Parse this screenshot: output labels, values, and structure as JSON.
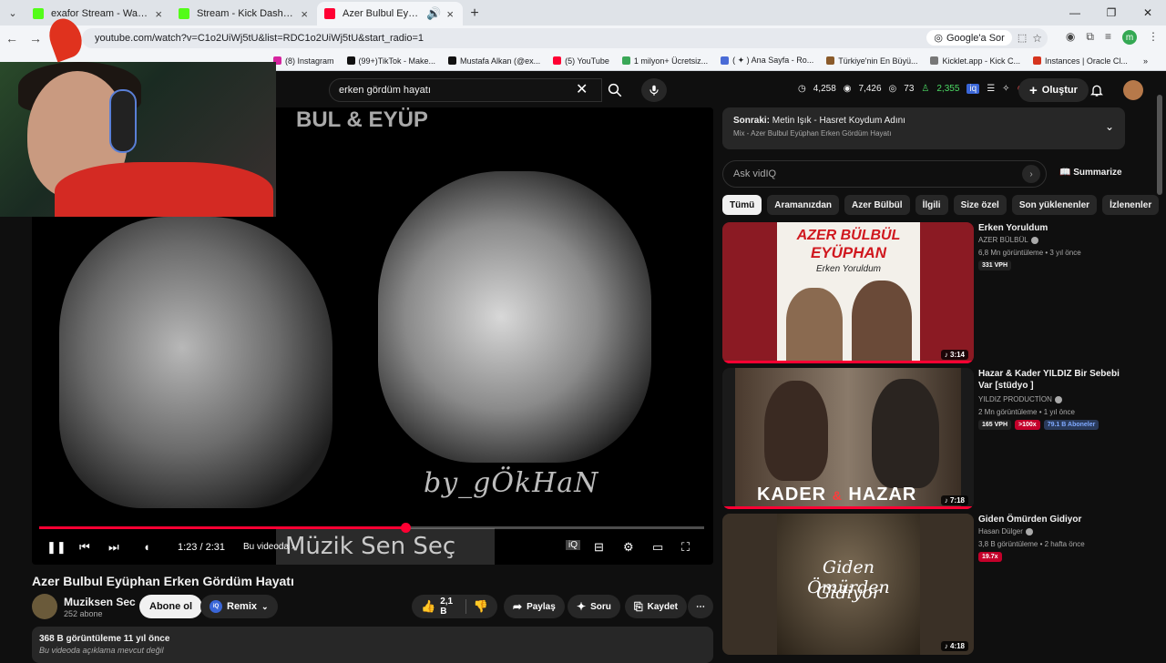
{
  "browser": {
    "tabs": [
      {
        "title": "exafor Stream - Watch Live on K",
        "favicon": "kick",
        "active": false
      },
      {
        "title": "Stream - Kick Dashboard",
        "favicon": "kick",
        "active": false
      },
      {
        "title": "Azer Bulbul Eyüphan Erken",
        "favicon": "youtube",
        "active": true
      }
    ],
    "url": "youtube.com/watch?v=C1o2UiWj5tU&list=RDC1o2UiWj5tU&start_radio=1",
    "google_ask": "Google'a Sor",
    "profile_letter": "m",
    "bookmarks": [
      {
        "label": "(8) Instagram",
        "color": "#d6249f"
      },
      {
        "label": "(99+)TikTok - Make...",
        "color": "#111111"
      },
      {
        "label": "Mustafa Alkan (@ex...",
        "color": "#111111"
      },
      {
        "label": "(5) YouTube",
        "color": "#ff0033"
      },
      {
        "label": "1 milyon+ Ücretsiz...",
        "color": "#3aa757"
      },
      {
        "label": "( ✦ ) Ana Sayfa - Ro...",
        "color": "#4a6bd6"
      },
      {
        "label": "Türkiye'nin En Büyü...",
        "color": "#8a5a2a"
      },
      {
        "label": "Kicklet.app - Kick C...",
        "color": "#777777"
      },
      {
        "label": "Instances | Oracle Cl...",
        "color": "#d6341e"
      }
    ]
  },
  "youtube": {
    "search_value": "erken gördüm hayatı",
    "stats": {
      "clock": "4,258",
      "views": "7,426",
      "eye": "73",
      "users": "2,355"
    },
    "create_label": "Oluştur",
    "video": {
      "top_watermark": "BUL & EYÜP",
      "watermark": "by_gÖkHaN",
      "banner": "Müzik Sen Seç",
      "time": "1:23 / 2:31",
      "progress": 0.55,
      "chapter": "Bu videoda"
    },
    "title": "Azer Bulbul Eyüphan Erken Gördüm Hayatı",
    "channel": {
      "name": "Muziksen Sec",
      "subs": "252 abone"
    },
    "subscribe_label": "Abone ol",
    "remix_label": "Remix",
    "actions": {
      "like": "2,1 B",
      "share": "Paylaş",
      "ask": "Soru",
      "save": "Kaydet"
    },
    "description": {
      "views": "368 B görüntüleme  11 yıl önce",
      "text": "Bu videoda açıklama mevcut değil"
    },
    "next_up": {
      "label": "Sonraki:",
      "title": "Metin Işık - Hasret Koydum Adını",
      "sub": "Mix - Azer Bulbul Eyüphan Erken Gördüm Hayatı"
    },
    "ask_placeholder": "Ask vidIQ",
    "summarize_label": "Summarize",
    "chips": [
      "Tümü",
      "Aramanızdan",
      "Azer Bülbül",
      "İlgili",
      "Size özel",
      "Son yüklenenler",
      "İzlenenler"
    ],
    "recommendations": [
      {
        "title": "Erken Yoruldum",
        "channel": "AZER BÜLBÜL",
        "meta": "6,8 Mn görüntüleme • 3 yıl önce",
        "badges": [
          {
            "text": "331 VPH",
            "kind": "dark"
          }
        ],
        "duration": "3:14",
        "thumb_text_1": "AZER BÜLBÜL",
        "thumb_text_2": "EYÜPHAN",
        "thumb_text_3": "Erken Yoruldum",
        "watched": 1.0
      },
      {
        "title": "Hazar & Kader YILDIZ Bir Sebebi Var [stüdyo ]",
        "channel": "YILDIZ PRODUCTİON",
        "meta": "2 Mn görüntüleme • 1 yıl önce",
        "badges": [
          {
            "text": "165 VPH",
            "kind": "dark"
          },
          {
            "text": ">100x",
            "kind": "red"
          },
          {
            "text": "79.1 B Aboneler",
            "kind": "blue"
          }
        ],
        "duration": "7:18",
        "thumb_text_1": "KADER",
        "thumb_text_2": "&",
        "thumb_text_3": "HAZAR",
        "watched": 1.0
      },
      {
        "title": "Giden Ömürden Gidiyor",
        "channel": "Hasan Dülger",
        "meta": "3,8 B görüntüleme • 2 hafta önce",
        "badges": [
          {
            "text": "19.7x",
            "kind": "red"
          }
        ],
        "duration": "4:18",
        "thumb_text_1": "Giden Ömürden",
        "thumb_text_2": "Gidiyor",
        "watched": 0
      }
    ]
  },
  "colors": {
    "accent": "#ff0033",
    "kick": "#53fc18",
    "bg": "#0f0f0f"
  }
}
